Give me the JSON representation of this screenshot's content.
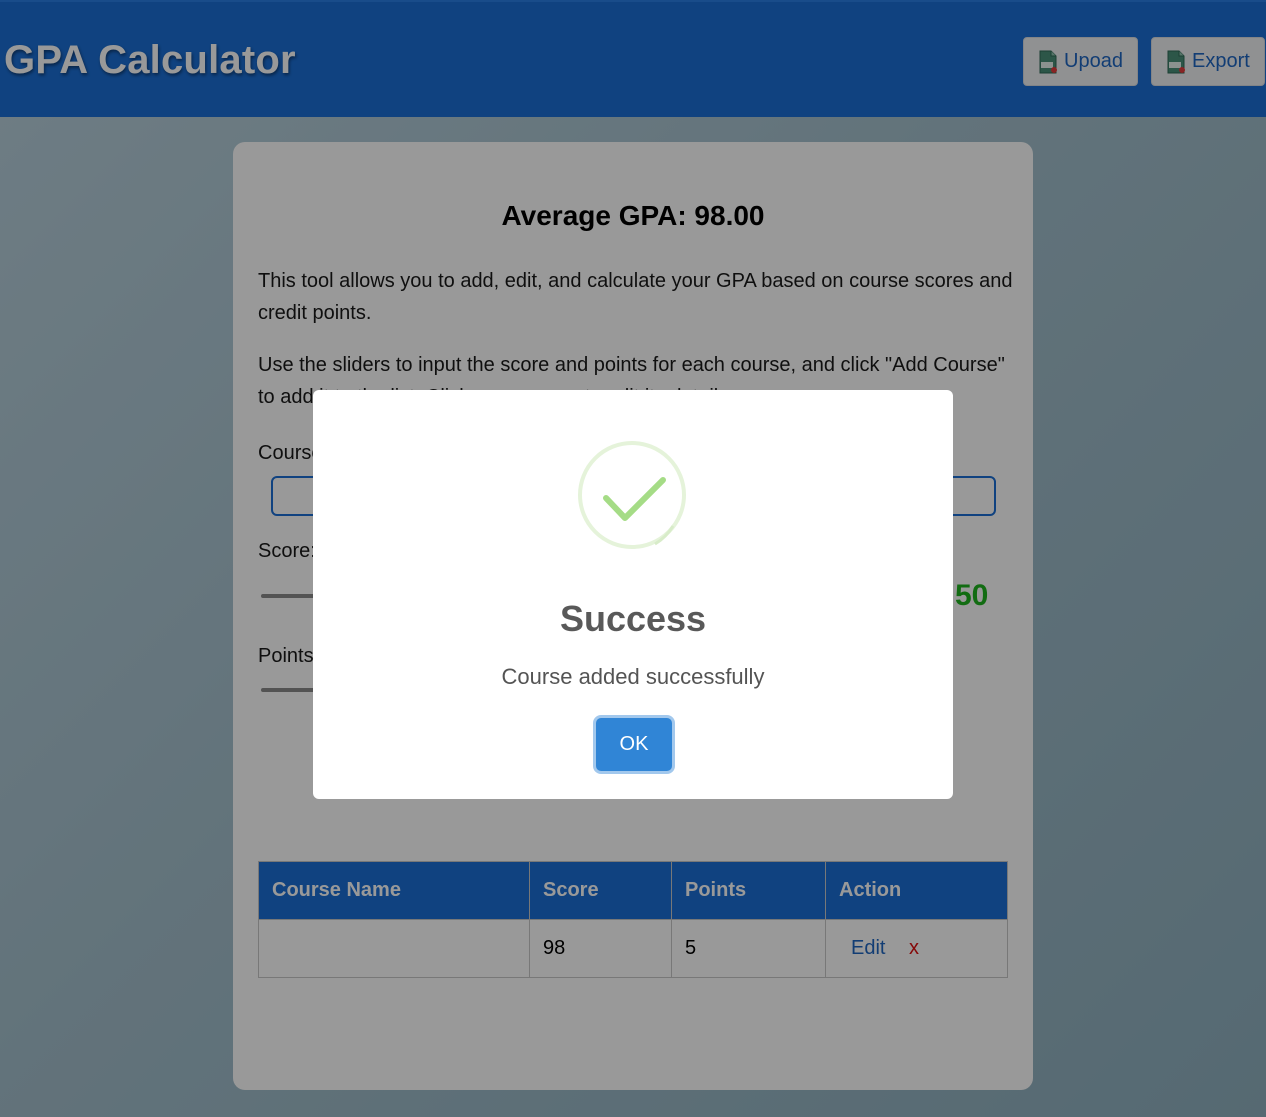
{
  "header": {
    "title": "GPA Calculator",
    "upload_label": "Upoad",
    "export_label": "Export"
  },
  "main": {
    "average_gpa": "Average GPA: 98.00",
    "description_1": "This tool allows you to add, edit, and calculate your GPA based on course scores and credit points.",
    "description_2": "Use the sliders to input the score and points for each course, and click \"Add Course\" to add it to the list. Click on a course to edit its details.",
    "course_label": "Course Name:",
    "course_input_value": "",
    "score_label": "Score:",
    "score_value": "50",
    "points_label": "Points:"
  },
  "table": {
    "headers": [
      "Course Name",
      "Score",
      "Points",
      "Action"
    ],
    "rows": [
      {
        "course": "",
        "score": "98",
        "points": "5",
        "edit": "Edit",
        "delete": "x"
      }
    ]
  },
  "dialog": {
    "title": "Success",
    "message": "Course added successfully",
    "ok_label": "OK"
  },
  "colors": {
    "primary": "#1b6fd6",
    "success": "#a5dc86",
    "score_value": "#1fb41f",
    "delete": "#e01010"
  },
  "icons": {
    "upload": "csv-file-icon",
    "export": "csv-file-icon",
    "dialog": "success-check-icon"
  }
}
